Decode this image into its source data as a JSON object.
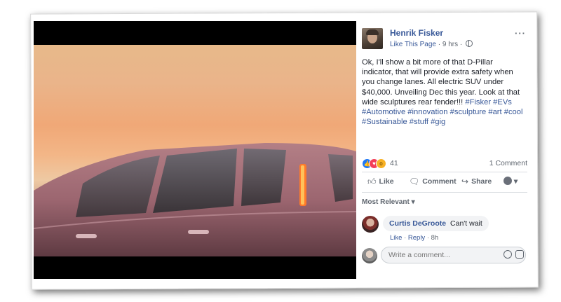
{
  "post": {
    "author": "Henrik Fisker",
    "meta_like": "Like This Page",
    "meta_time": "· 9 hrs ·",
    "more": "···",
    "text": "Ok, I'll show a bit more of that D-Pillar indicator, that will provide extra safety when you change lanes. All electric SUV under $40,000. Unveiling Dec this year. Look at that wide sculptures rear fender!!!",
    "hashtags": "#Fisker #EVs #Automotive #innovation #sculpture #art #cool #Sustainable #stuff #gig"
  },
  "reactions": {
    "count": "41",
    "comments": "1 Comment",
    "icons": [
      "like-icon",
      "love-icon",
      "wow-icon"
    ]
  },
  "actions": {
    "like": "Like",
    "comment": "Comment",
    "share": "Share",
    "audience": "▾"
  },
  "sort": {
    "label": "Most Relevant ▾"
  },
  "comments": [
    {
      "name": "Curtis DeGroote",
      "text": "Can't wait",
      "like": "Like",
      "reply": "Reply",
      "time": "· 8h"
    }
  ],
  "composer": {
    "placeholder": "Write a comment..."
  },
  "colors": {
    "link": "#385898",
    "like": "#2078f4",
    "love": "#f33e58",
    "wow": "#f7b125"
  }
}
